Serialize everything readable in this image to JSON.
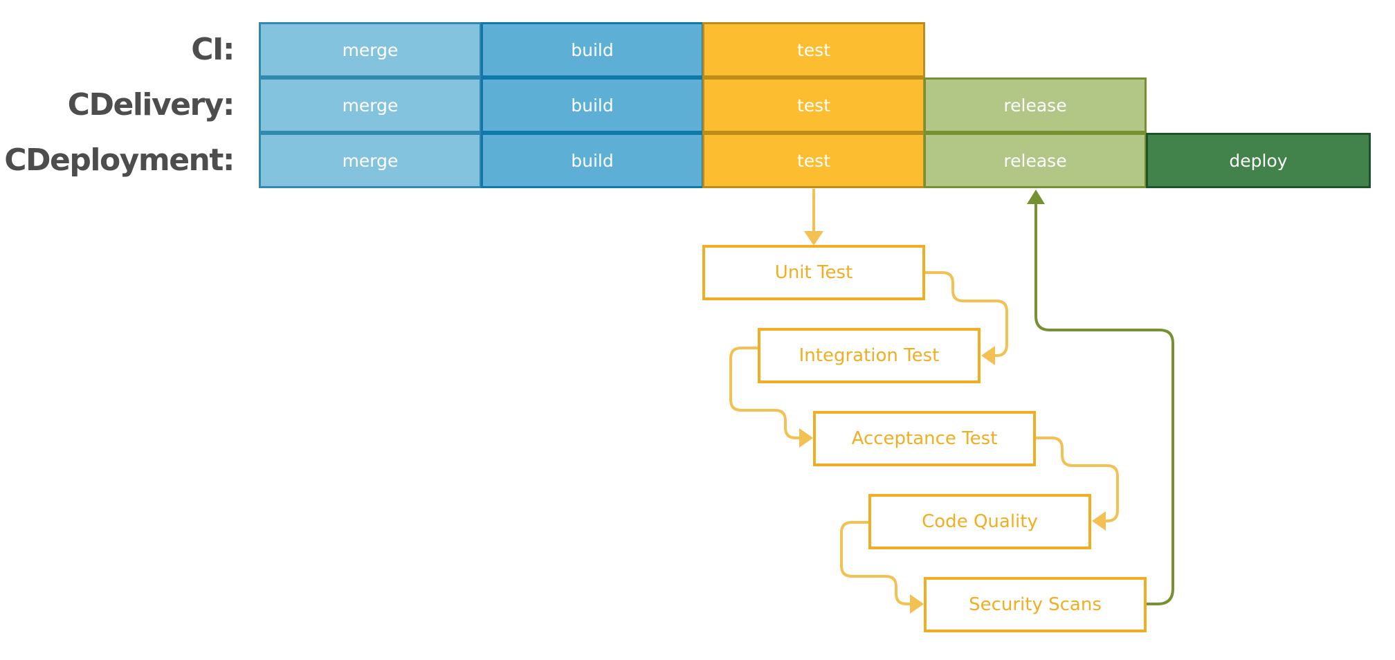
{
  "rows": [
    {
      "label": "CI:",
      "stages": [
        "merge",
        "build",
        "test"
      ]
    },
    {
      "label": "CDelivery:",
      "stages": [
        "merge",
        "build",
        "test",
        "release"
      ]
    },
    {
      "label": "CDeployment:",
      "stages": [
        "merge",
        "build",
        "test",
        "release",
        "deploy"
      ]
    }
  ],
  "test_steps": [
    "Unit Test",
    "Integration Test",
    "Acceptance Test",
    "Code Quality",
    "Security Scans"
  ],
  "colors": {
    "merge": "#84c3dd",
    "build": "#5dafd6",
    "test": "#fcbd31",
    "release": "#b2c686",
    "deploy": "#41834a",
    "test_step_outline": "#f1ae22",
    "test_connector": "#f3c153",
    "release_connector": "#759132",
    "label_text": "#4d4d4d"
  }
}
